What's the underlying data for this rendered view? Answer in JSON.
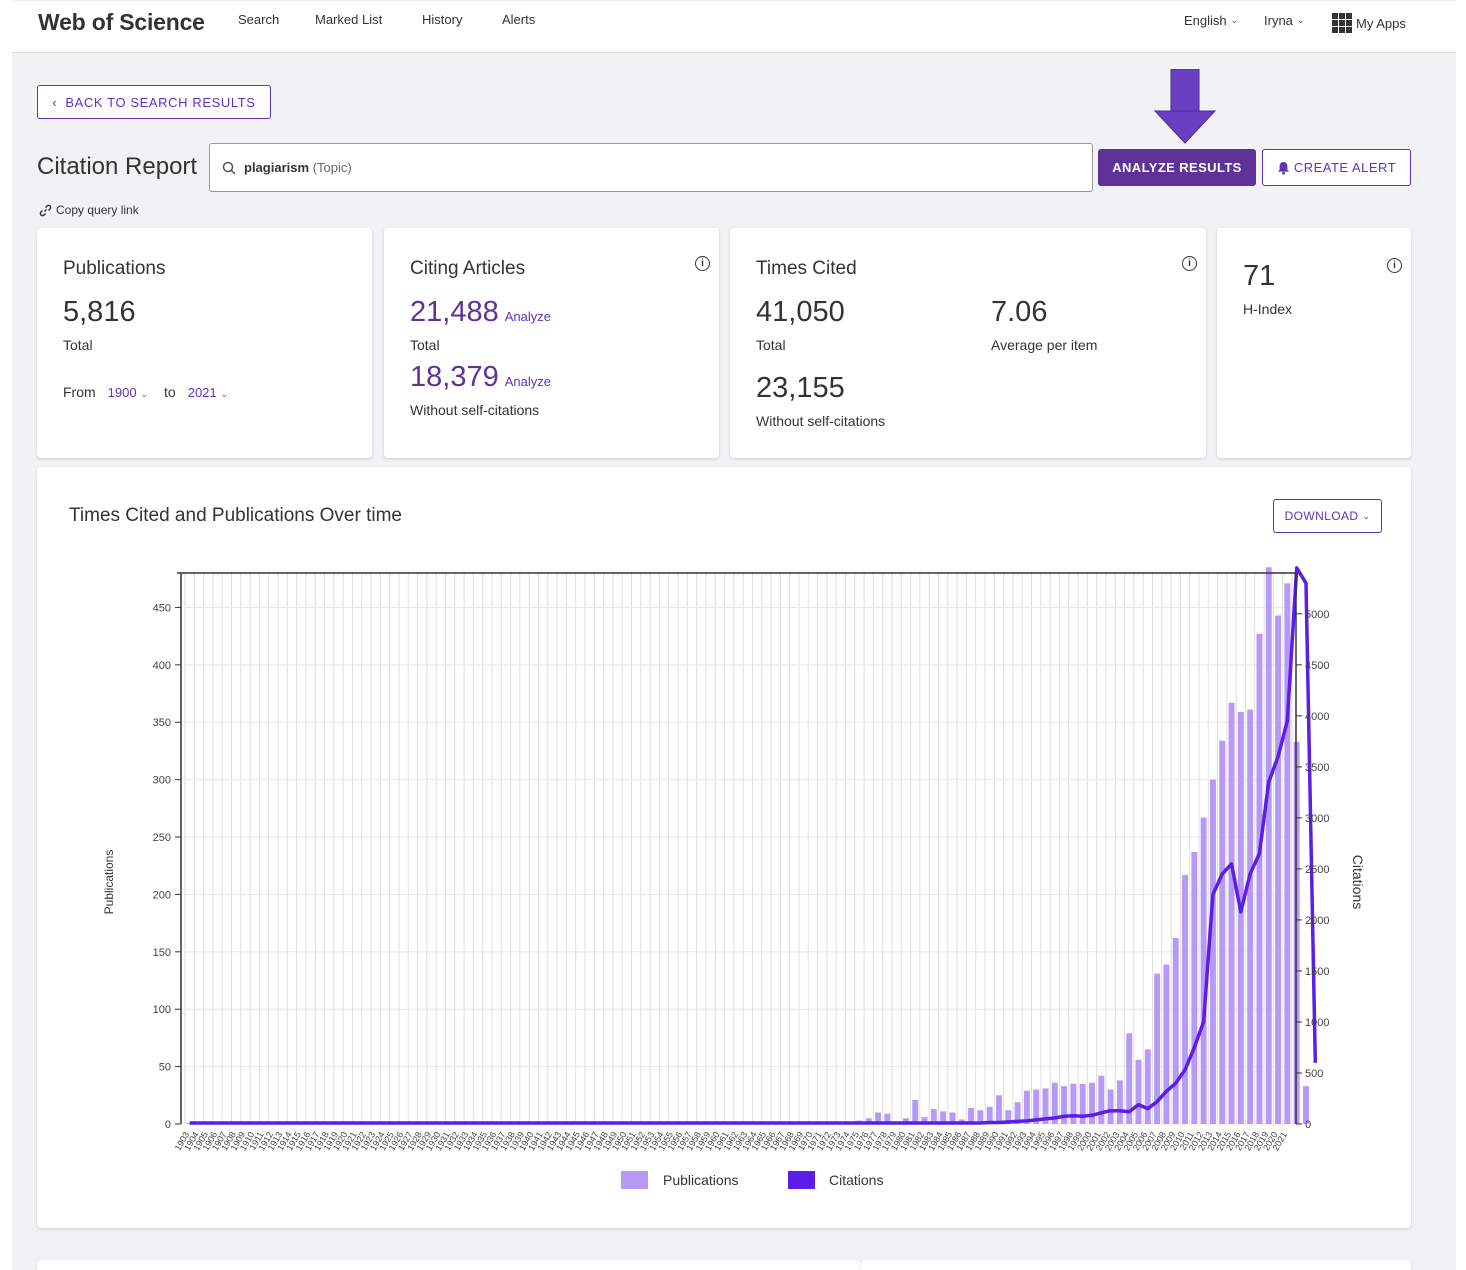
{
  "header": {
    "brand": "Web of Science",
    "nav": [
      "Search",
      "Marked List",
      "History",
      "Alerts"
    ],
    "language": "English",
    "user": "Iryna",
    "apps": "My Apps"
  },
  "back_button": "BACK TO SEARCH RESULTS",
  "page_title": "Citation Report",
  "search": {
    "query": "plagiarism",
    "field": "(Topic)"
  },
  "analyze_button": "ANALYZE RESULTS",
  "create_alert_button": "CREATE ALERT",
  "copy_query_link": "Copy query link",
  "cards": {
    "publications": {
      "title": "Publications",
      "total": "5,816",
      "total_label": "Total",
      "from_label": "From",
      "from_year": "1900",
      "to_label": "to",
      "to_year": "2021"
    },
    "citing": {
      "title": "Citing Articles",
      "total": "21,488",
      "total_label": "Total",
      "without": "18,379",
      "without_label": "Without self-citations",
      "analyze": "Analyze"
    },
    "times_cited": {
      "title": "Times Cited",
      "total": "41,050",
      "total_label": "Total",
      "avg": "7.06",
      "avg_label": "Average per item",
      "without": "23,155",
      "without_label": "Without self-citations"
    },
    "hindex": {
      "value": "71",
      "label": "H-Index"
    }
  },
  "chart_section": {
    "title": "Times Cited and Publications Over time",
    "download": "DOWNLOAD"
  },
  "colors": {
    "accent": "#5e33bf",
    "analyze_bg": "#5e3296",
    "bar": "#b79af7",
    "line": "#5b1de8"
  },
  "chart_data": {
    "type": "bar+line",
    "x": [
      1903,
      1904,
      1905,
      1906,
      1907,
      1908,
      1909,
      1910,
      1911,
      1912,
      1913,
      1914,
      1915,
      1916,
      1917,
      1918,
      1919,
      1920,
      1921,
      1922,
      1923,
      1924,
      1925,
      1926,
      1927,
      1928,
      1929,
      1930,
      1931,
      1932,
      1933,
      1934,
      1935,
      1936,
      1937,
      1938,
      1939,
      1940,
      1941,
      1942,
      1943,
      1944,
      1945,
      1946,
      1947,
      1948,
      1949,
      1950,
      1951,
      1952,
      1953,
      1954,
      1955,
      1956,
      1957,
      1958,
      1959,
      1960,
      1961,
      1962,
      1963,
      1964,
      1965,
      1966,
      1967,
      1968,
      1969,
      1970,
      1971,
      1972,
      1973,
      1974,
      1975,
      1976,
      1977,
      1978,
      1979,
      1980,
      1981,
      1982,
      1983,
      1984,
      1985,
      1986,
      1987,
      1988,
      1989,
      1990,
      1991,
      1992,
      1993,
      1994,
      1995,
      1996,
      1997,
      1998,
      1999,
      2000,
      2001,
      2002,
      2003,
      2004,
      2005,
      2006,
      2007,
      2008,
      2009,
      2010,
      2011,
      2012,
      2013,
      2014,
      2015,
      2016,
      2017,
      2018,
      2019,
      2020,
      2021
    ],
    "series": [
      {
        "name": "Publications",
        "axis": "left",
        "type": "bar",
        "values": [
          1,
          0,
          1,
          0,
          1,
          0,
          1,
          0,
          1,
          0,
          1,
          0,
          1,
          0,
          1,
          0,
          1,
          1,
          1,
          1,
          1,
          1,
          1,
          1,
          1,
          1,
          1,
          1,
          1,
          1,
          1,
          1,
          1,
          1,
          1,
          1,
          1,
          1,
          1,
          1,
          1,
          1,
          1,
          1,
          1,
          1,
          1,
          1,
          1,
          1,
          2,
          2,
          2,
          2,
          2,
          2,
          2,
          2,
          2,
          1,
          1,
          1,
          1,
          1,
          1,
          1,
          1,
          1,
          1,
          1,
          2,
          2,
          3,
          5,
          10,
          9,
          2,
          5,
          21,
          6,
          13,
          11,
          10,
          4,
          14,
          12,
          15,
          25,
          12,
          19,
          29,
          30,
          31,
          36,
          33,
          35,
          35,
          36,
          42,
          30,
          38,
          79,
          56,
          65,
          131,
          139,
          162,
          217,
          237,
          267,
          300,
          334,
          367,
          359,
          361,
          427,
          485,
          443,
          471,
          333,
          33
        ]
      },
      {
        "name": "Citations",
        "axis": "right",
        "type": "line",
        "values": [
          10,
          10,
          10,
          10,
          10,
          10,
          10,
          10,
          10,
          10,
          10,
          10,
          10,
          10,
          10,
          10,
          10,
          10,
          10,
          10,
          10,
          10,
          10,
          10,
          10,
          10,
          10,
          10,
          10,
          10,
          10,
          10,
          10,
          10,
          10,
          10,
          10,
          10,
          10,
          10,
          10,
          10,
          10,
          10,
          10,
          10,
          10,
          10,
          10,
          10,
          10,
          10,
          10,
          10,
          10,
          10,
          10,
          10,
          10,
          10,
          10,
          10,
          10,
          10,
          10,
          10,
          10,
          10,
          10,
          10,
          10,
          10,
          10,
          10,
          10,
          10,
          10,
          10,
          10,
          10,
          10,
          10,
          10,
          10,
          10,
          10,
          15,
          15,
          20,
          25,
          30,
          40,
          50,
          60,
          75,
          80,
          75,
          85,
          110,
          130,
          130,
          120,
          190,
          150,
          220,
          320,
          400,
          530,
          750,
          1000,
          2250,
          2450,
          2550,
          2080,
          2450,
          2650,
          3350,
          3600,
          3950,
          5450,
          5300,
          600
        ]
      }
    ],
    "ylabel_left": "Publications",
    "ylabel_right": "Citations",
    "ylim_left": [
      0,
      480
    ],
    "ylim_right": [
      0,
      5400
    ],
    "yticks_left": [
      0,
      50,
      100,
      150,
      200,
      250,
      300,
      350,
      400,
      450
    ],
    "yticks_right": [
      0,
      500,
      1000,
      1500,
      2000,
      2500,
      3000,
      3500,
      4000,
      4500,
      5000
    ],
    "grid": true,
    "legend": "bottom-center"
  }
}
